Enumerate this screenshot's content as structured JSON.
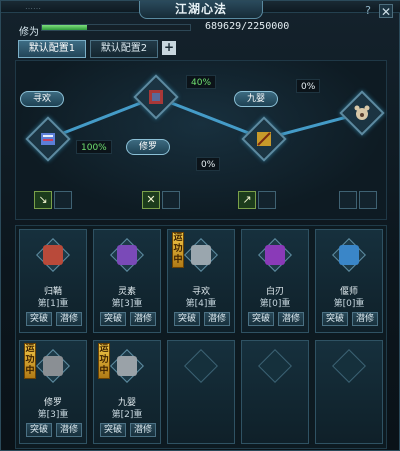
{
  "window": {
    "title": "江湖心法",
    "top_faded_text": "……",
    "help": "?",
    "close": "✕"
  },
  "xiuwei": {
    "label": "修为",
    "value_text": "689629/2250000",
    "progress": 0.3065
  },
  "configs": {
    "tabs": [
      "默认配置1",
      "默认配置2"
    ],
    "active": 0,
    "add": "+"
  },
  "path": {
    "nodes": [
      {
        "name": "寻欢",
        "icon": "scroll-blue-icon"
      },
      {
        "name": "修罗",
        "icon": "armor-red-icon"
      },
      {
        "name": "九婴",
        "icon": "gold-blade-icon"
      },
      {
        "name": "",
        "icon": "bear-paw-icon"
      }
    ],
    "percents": [
      "100%",
      "40%",
      "0%",
      "0%"
    ]
  },
  "equip_slots": {
    "icons": [
      "dagger-icon",
      "",
      "claw-icon",
      "",
      "sword-icon",
      "",
      "",
      ""
    ]
  },
  "grid": {
    "cards": [
      {
        "name": "归鞘",
        "level": "第[1]重",
        "active": false,
        "icon": "book-red-icon",
        "color": "#b94a3a"
      },
      {
        "name": "灵素",
        "level": "第[3]重",
        "active": false,
        "icon": "book-purple-icon",
        "color": "#7a4ab8"
      },
      {
        "name": "寻欢",
        "level": "第[4]重",
        "active": true,
        "icon": "scroll-grey-icon",
        "color": "#9aa6ae"
      },
      {
        "name": "白刃",
        "level": "第[0]重",
        "active": false,
        "icon": "orb-purple-icon",
        "color": "#8a3ab8"
      },
      {
        "name": "偃师",
        "level": "第[0]重",
        "active": false,
        "icon": "cube-blue-icon",
        "color": "#3a86c8"
      },
      {
        "name": "修罗",
        "level": "第[3]重",
        "active": true,
        "icon": "armor-grey-icon",
        "color": "#8a8f94"
      },
      {
        "name": "九婴",
        "level": "第[2]重",
        "active": true,
        "icon": "blade-grey-icon",
        "color": "#9aa2a8"
      }
    ],
    "empty_count": 3,
    "btn_break": "突破",
    "btn_latent": "潜修",
    "badge_text": "运功中"
  }
}
